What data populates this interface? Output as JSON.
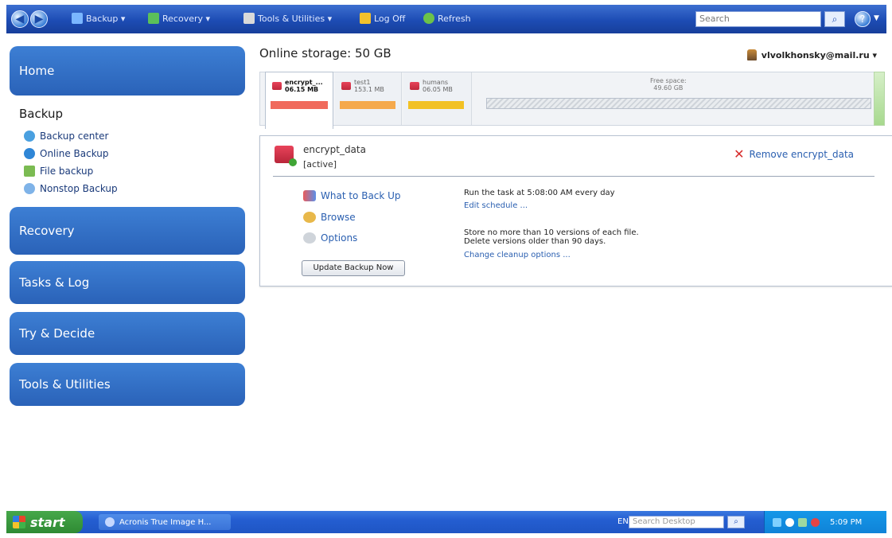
{
  "toolbar": {
    "items": [
      {
        "label": "Backup ▾",
        "icon": "backup-icon"
      },
      {
        "label": "Recovery ▾",
        "icon": "recovery-icon"
      },
      {
        "label": "Tools & Utilities ▾",
        "icon": "tools-icon"
      },
      {
        "label": "Log Off",
        "icon": "logoff-icon"
      },
      {
        "label": "Refresh",
        "icon": "refresh-icon"
      }
    ],
    "search_placeholder": "Search"
  },
  "sidebar": {
    "home": "Home",
    "backup_title": "Backup",
    "backup_items": [
      {
        "label": "Backup center"
      },
      {
        "label": "Online Backup"
      },
      {
        "label": "File backup"
      },
      {
        "label": "Nonstop Backup"
      }
    ],
    "recovery": "Recovery",
    "tasks": "Tasks & Log",
    "try_decide": "Try & Decide",
    "tools": "Tools & Utilities"
  },
  "main": {
    "storage_title": "Online storage: 50 GB",
    "user": "vlvolkhonsky@mail.ru ▾",
    "storage_slots": [
      {
        "name": "encrypt_...",
        "size": "06.15 MB",
        "bar_color": "#f06a5c"
      },
      {
        "name": "test1",
        "size": "153.1 MB",
        "bar_color": "#f5a94c"
      },
      {
        "name": "humans",
        "size": "06.05 MB",
        "bar_color": "#f2c124"
      }
    ],
    "free_space_label": "Free space:",
    "free_space_value": "49.60 GB",
    "backup_name": "encrypt_data",
    "backup_status": "[active]",
    "remove_label": "Remove encrypt_data",
    "actions": {
      "what": "What to Back Up",
      "browse": "Browse",
      "options": "Options"
    },
    "update_button": "Update Backup Now",
    "schedule_text": "Run the task at 5:08:00 AM every day",
    "edit_schedule": "Edit schedule ...",
    "store_text": "Store no more than 10 versions of each file.",
    "delete_text": "Delete versions older than 90 days.",
    "cleanup_link": "Change cleanup options ..."
  },
  "taskbar": {
    "start": "start",
    "task": "Acronis True Image H...",
    "lang": "EN",
    "desktop_search": "Search Desktop",
    "clock": "5:09 PM"
  }
}
